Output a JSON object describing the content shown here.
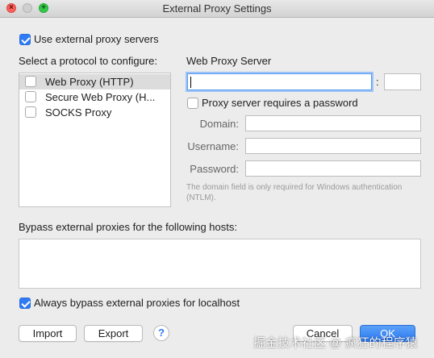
{
  "window": {
    "title": "External Proxy Settings",
    "close": "×",
    "zoom": "+"
  },
  "use_external": {
    "label": "Use external proxy servers",
    "checked": true
  },
  "protocols": {
    "heading": "Select a protocol to configure:",
    "items": [
      {
        "label": "Web Proxy (HTTP)",
        "checked": false,
        "selected": true
      },
      {
        "label": "Secure Web Proxy (H...",
        "checked": false,
        "selected": false
      },
      {
        "label": "SOCKS Proxy",
        "checked": false,
        "selected": false
      }
    ]
  },
  "server": {
    "heading": "Web Proxy Server",
    "host_value": "",
    "colon": ":",
    "port_value": "",
    "requires_password_label": "Proxy server requires a password",
    "requires_password": false,
    "domain_label": "Domain:",
    "username_label": "Username:",
    "password_label": "Password:",
    "hint": "The domain field is only required for Windows authentication (NTLM)."
  },
  "bypass": {
    "heading": "Bypass external proxies for the following hosts:",
    "hosts": "",
    "localhost_label": "Always bypass external proxies for localhost",
    "localhost_checked": true
  },
  "buttons": {
    "import": "Import",
    "export": "Export",
    "help": "?",
    "cancel": "Cancel",
    "ok": "OK"
  },
  "watermark": "掘金技术社区 @ 疯狂的程序猿"
}
